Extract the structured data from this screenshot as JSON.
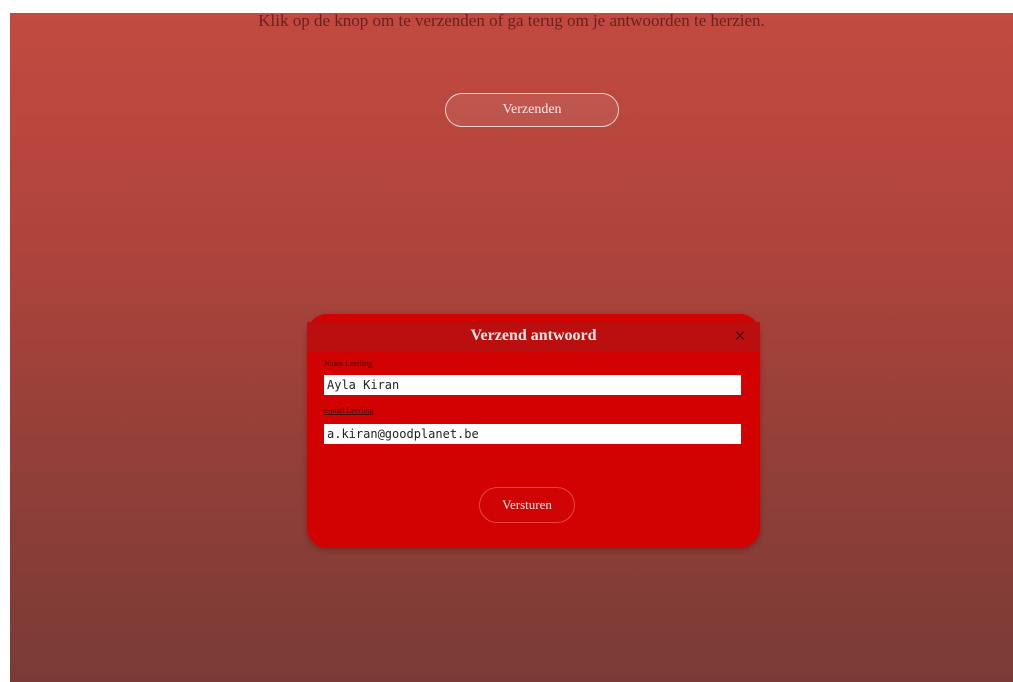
{
  "page": {
    "instruction": "Klik op de knop om te verzenden of ga terug om je antwoorden te herzien.",
    "send_button_label": "Verzenden"
  },
  "modal": {
    "title": "Verzend antwoord",
    "close_icon": "×",
    "fields": [
      {
        "label": "Naam Leerling",
        "value": "Ayla Kiran"
      },
      {
        "label": "e-mail Leerling",
        "value": "a.kiran@goodplanet.be"
      }
    ],
    "submit_label": "Versturen"
  },
  "colors": {
    "background_top": "#c24a40",
    "background_bottom": "#7a3b36",
    "modal": "#d20202",
    "modal_header": "#bb0e0e"
  }
}
